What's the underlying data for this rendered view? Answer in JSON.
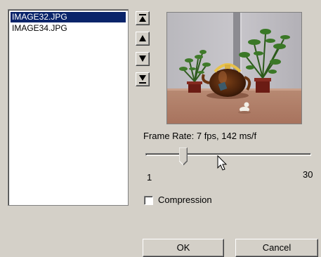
{
  "file_list": {
    "items": [
      {
        "label": "IMAGE32.JPG",
        "selected": true
      },
      {
        "label": "IMAGE34.JPG",
        "selected": false
      }
    ]
  },
  "order_buttons": {
    "icons": [
      "move-to-top-icon",
      "move-up-icon",
      "move-down-icon",
      "move-to-bottom-icon"
    ]
  },
  "frame_rate": {
    "label": "Frame Rate: 7 fps, 142 ms/f",
    "min_label": "1",
    "max_label": "30",
    "value": 7
  },
  "compression": {
    "label": "Compression",
    "checked": false
  },
  "buttons": {
    "ok": "OK",
    "cancel": "Cancel"
  },
  "colors": {
    "dialog_bg": "#d4d0c8",
    "selection_bg": "#0a246a",
    "selection_fg": "#ffffff"
  }
}
